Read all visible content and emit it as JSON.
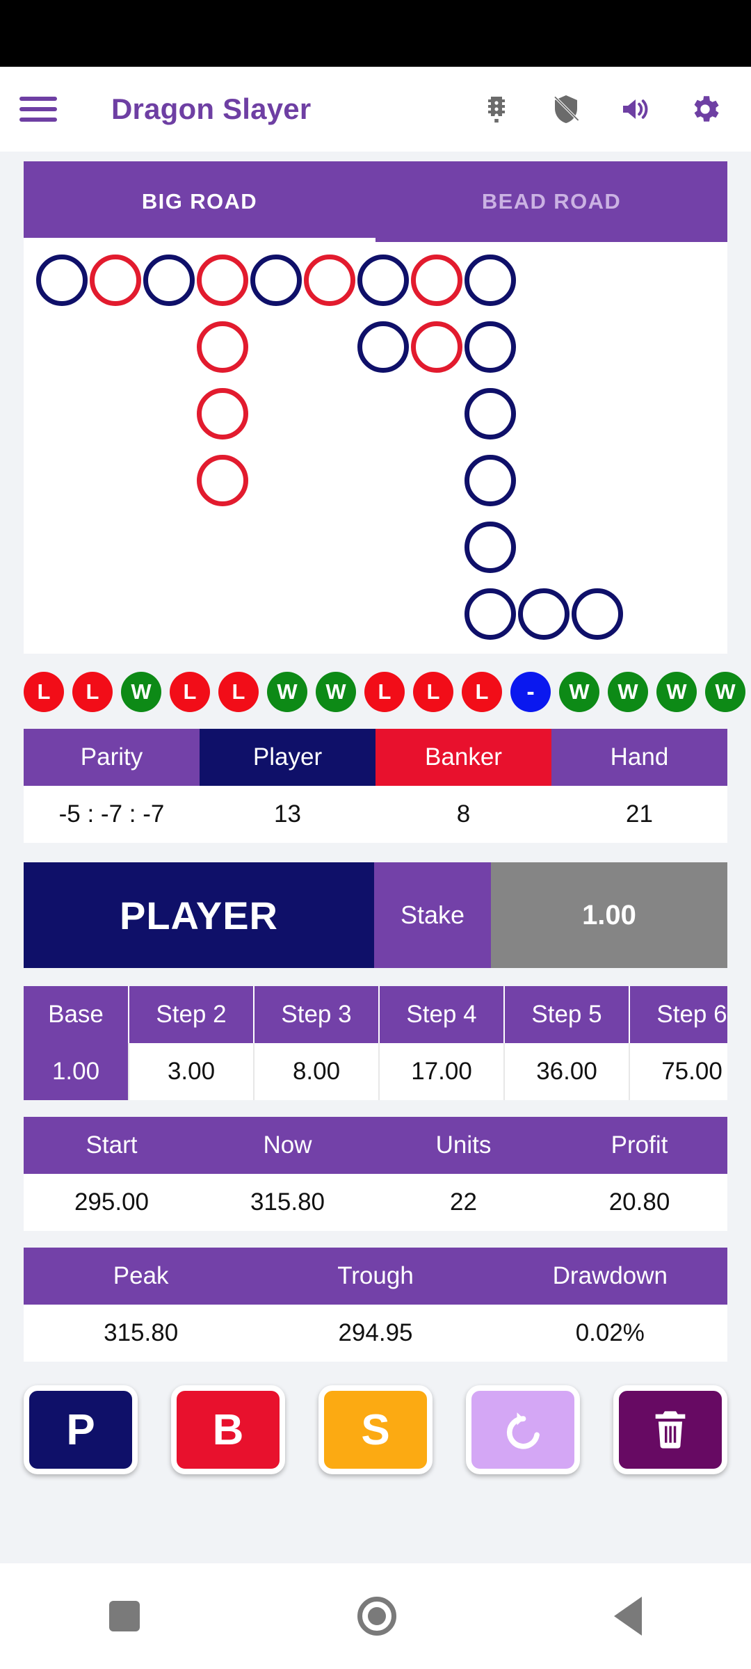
{
  "app": {
    "title": "Dragon Slayer",
    "menu_icon": "hamburger-icon",
    "actions": [
      {
        "name": "traffic-light-icon",
        "color": "#6b6b6b"
      },
      {
        "name": "shield-off-icon",
        "color": "#6b6b6b"
      },
      {
        "name": "volume-up-icon",
        "color": "#6e3fa3"
      },
      {
        "name": "gear-icon",
        "color": "#6e3fa3"
      }
    ]
  },
  "tabs": [
    {
      "label": "BIG ROAD",
      "active": true
    },
    {
      "label": "BEAD ROAD",
      "active": false
    }
  ],
  "colors": {
    "purple": "#7341a8",
    "navy": "#0f1069",
    "red": "#e8112d",
    "green": "#0d8a16",
    "blue": "#0a18ef",
    "orange": "#fcaa12",
    "grey": "#858585",
    "lilac": "#d4a7f5",
    "plum": "#670a63"
  },
  "big_road": {
    "cols": 12,
    "rows": 6,
    "cells": [
      {
        "col": 0,
        "row": 0,
        "side": "blue"
      },
      {
        "col": 1,
        "row": 0,
        "side": "red"
      },
      {
        "col": 2,
        "row": 0,
        "side": "blue"
      },
      {
        "col": 3,
        "row": 0,
        "side": "red"
      },
      {
        "col": 3,
        "row": 1,
        "side": "red"
      },
      {
        "col": 3,
        "row": 2,
        "side": "red"
      },
      {
        "col": 3,
        "row": 3,
        "side": "red"
      },
      {
        "col": 4,
        "row": 0,
        "side": "blue"
      },
      {
        "col": 5,
        "row": 0,
        "side": "red"
      },
      {
        "col": 6,
        "row": 0,
        "side": "blue"
      },
      {
        "col": 6,
        "row": 1,
        "side": "blue"
      },
      {
        "col": 7,
        "row": 0,
        "side": "red"
      },
      {
        "col": 7,
        "row": 1,
        "side": "red"
      },
      {
        "col": 8,
        "row": 0,
        "side": "blue"
      },
      {
        "col": 8,
        "row": 1,
        "side": "blue"
      },
      {
        "col": 8,
        "row": 2,
        "side": "blue"
      },
      {
        "col": 8,
        "row": 3,
        "side": "blue"
      },
      {
        "col": 8,
        "row": 4,
        "side": "blue"
      },
      {
        "col": 8,
        "row": 5,
        "side": "blue"
      },
      {
        "col": 9,
        "row": 5,
        "side": "blue"
      },
      {
        "col": 10,
        "row": 5,
        "side": "blue"
      }
    ]
  },
  "results": [
    "L",
    "L",
    "W",
    "L",
    "L",
    "W",
    "W",
    "L",
    "L",
    "L",
    "-",
    "W",
    "W",
    "W",
    "W"
  ],
  "parity_table": {
    "headers": [
      "Parity",
      "Player",
      "Banker",
      "Hand"
    ],
    "values": [
      "-5 : -7 : -7",
      "13",
      "8",
      "21"
    ]
  },
  "bet_panel": {
    "side": "PLAYER",
    "stake_label": "Stake",
    "stake_value": "1.00"
  },
  "steps_table": {
    "headers": [
      "Base",
      "Step 2",
      "Step 3",
      "Step 4",
      "Step 5",
      "Step 6"
    ],
    "values": [
      "1.00",
      "3.00",
      "8.00",
      "17.00",
      "36.00",
      "75.00"
    ]
  },
  "bank_table": {
    "headers": [
      "Start",
      "Now",
      "Units",
      "Profit"
    ],
    "values": [
      "295.00",
      "315.80",
      "22",
      "20.80"
    ]
  },
  "peak_table": {
    "headers": [
      "Peak",
      "Trough",
      "Drawdown"
    ],
    "values": [
      "315.80",
      "294.95",
      "0.02%"
    ]
  },
  "action_buttons": [
    {
      "label": "P",
      "name": "player-button",
      "style": "p"
    },
    {
      "label": "B",
      "name": "banker-button",
      "style": "b"
    },
    {
      "label": "S",
      "name": "skip-button",
      "style": "s"
    },
    {
      "label": "",
      "name": "undo-button",
      "style": "u",
      "icon": "undo-icon"
    },
    {
      "label": "",
      "name": "delete-button",
      "style": "d",
      "icon": "trash-icon"
    }
  ],
  "navbar": [
    {
      "name": "recents-button"
    },
    {
      "name": "home-button"
    },
    {
      "name": "back-button"
    }
  ]
}
